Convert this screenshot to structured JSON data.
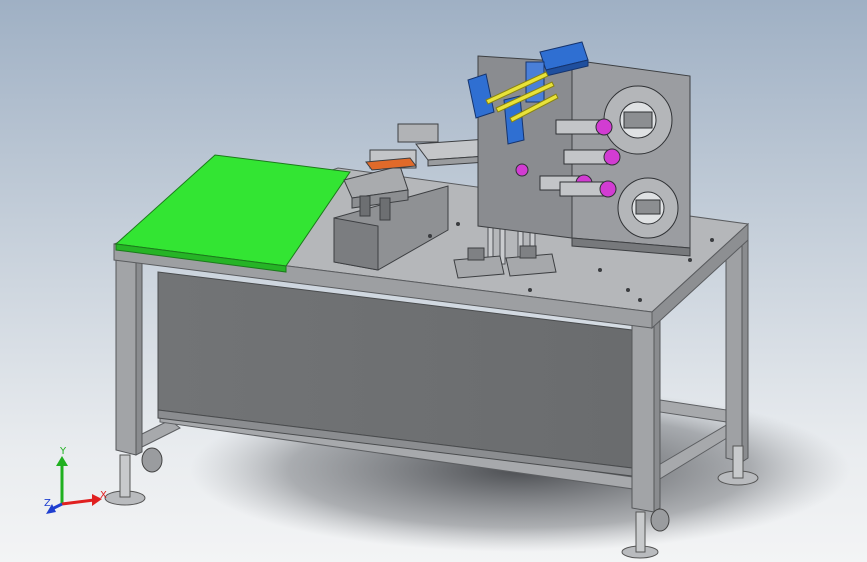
{
  "viewport": {
    "background_top": "#9fb0c4",
    "background_bottom": "#f3f4f5"
  },
  "model": {
    "frame_color": "#9c9ea2",
    "tabletop_color": "#b3b5b8",
    "cabinet_color": "#707274",
    "green_plate_color": "#33e533",
    "cylinder_blue": "#2f6fd2",
    "rod_yellow": "#e8e23a",
    "bearing_magenta": "#d23cd2",
    "plate_color": "#8a8c90"
  },
  "triad": {
    "x_label": "X",
    "y_label": "Y",
    "z_label": "Z",
    "x_color": "#e02020",
    "y_color": "#20b020",
    "z_color": "#1f3fd0"
  }
}
